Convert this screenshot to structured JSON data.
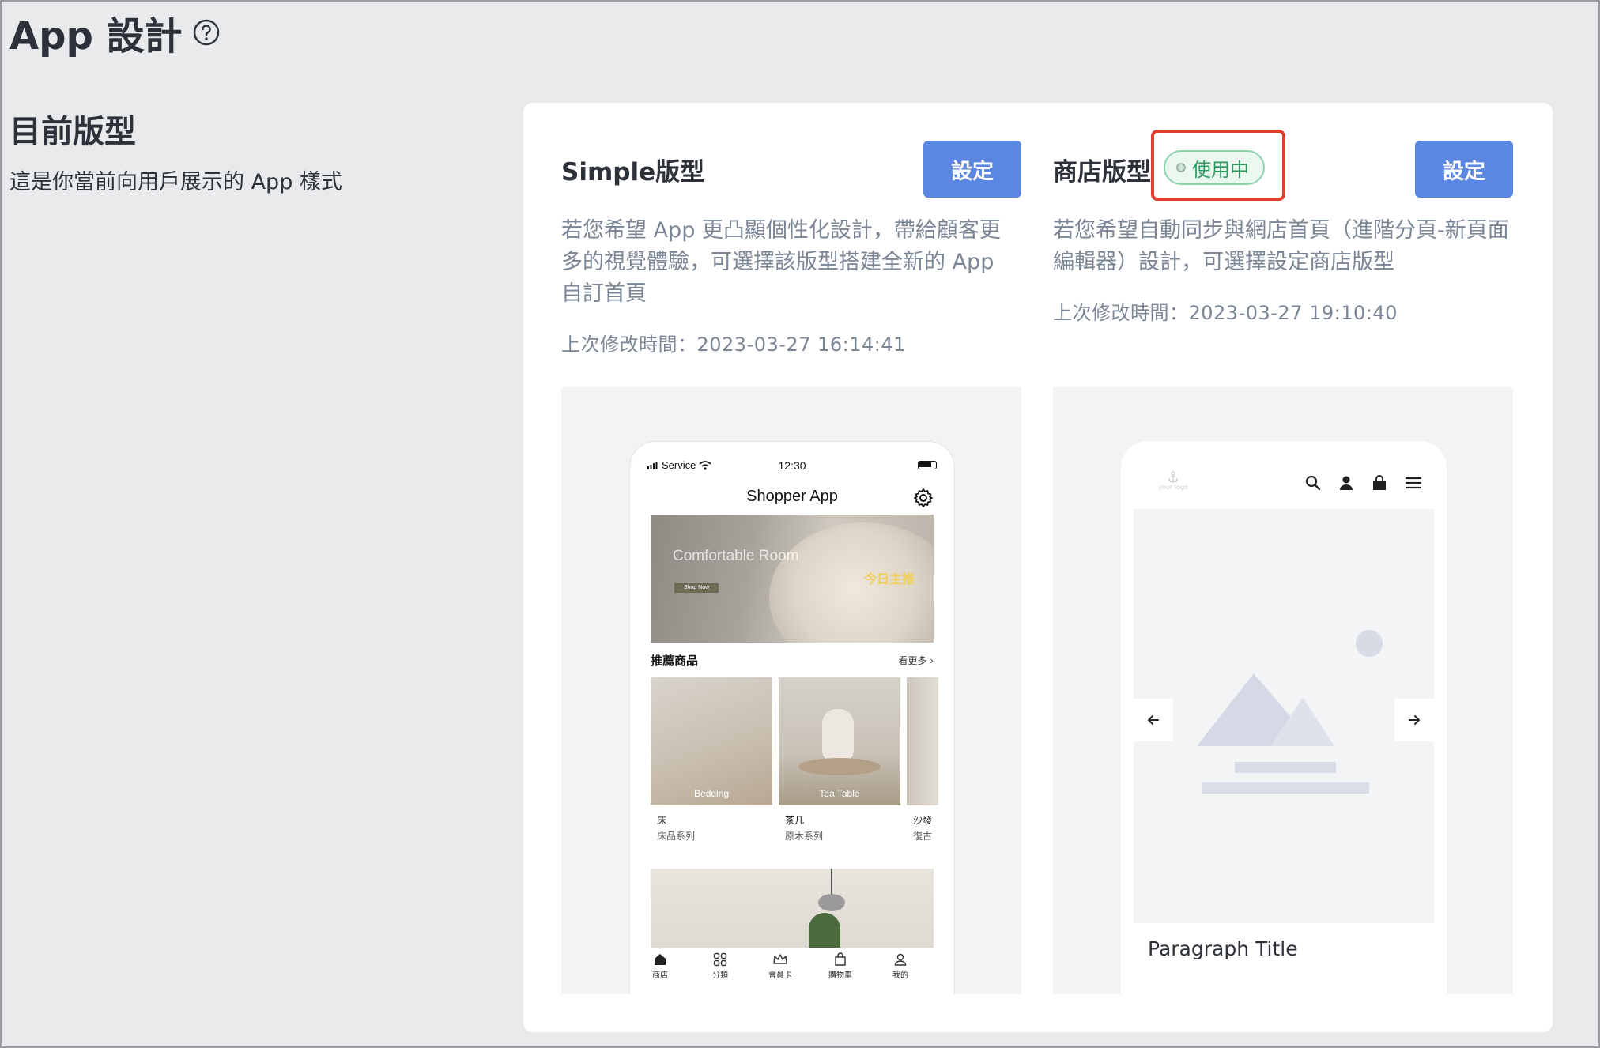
{
  "header": {
    "title": "App 設計"
  },
  "section": {
    "title": "目前版型",
    "description": "這是你當前向用戶展示的 App 樣式"
  },
  "templates": [
    {
      "name": "Simple版型",
      "button": "設定",
      "description": "若您希望 App 更凸顯個性化設計，帶給顧客更多的視覺體驗，可選擇該版型搭建全新的 App 自訂首頁",
      "last_modified": "上次修改時間：2023-03-27 16:14:41",
      "preview": {
        "status_carrier": "Service",
        "status_time": "12:30",
        "app_title": "Shopper App",
        "banner_title": "Comfortable Room",
        "banner_button": "Shop Now",
        "banner_tag": "今日主推",
        "recommend_title": "推薦商品",
        "recommend_more": "看更多 ›",
        "products": [
          {
            "image_label": "Bedding",
            "name": "床",
            "series": "床品系列"
          },
          {
            "image_label": "Tea Table",
            "name": "茶几",
            "series": "原木系列"
          },
          {
            "image_label": "",
            "name": "沙發",
            "series": "復古"
          }
        ],
        "tabs": [
          "商店",
          "分類",
          "會員卡",
          "購物車",
          "我的"
        ]
      }
    },
    {
      "name": "商店版型",
      "button": "設定",
      "status": "使用中",
      "description": "若您希望自動同步與網店首頁（進階分頁-新頁面編輯器）設計，可選擇設定商店版型",
      "last_modified": "上次修改時間：2023-03-27 19:10:40",
      "preview": {
        "logo_text": "your logo",
        "paragraph_title": "Paragraph Title"
      }
    }
  ],
  "colors": {
    "primary_button": "#5b87e0",
    "status_green": "#2f9a5f",
    "highlight_red": "#e03d2f"
  }
}
